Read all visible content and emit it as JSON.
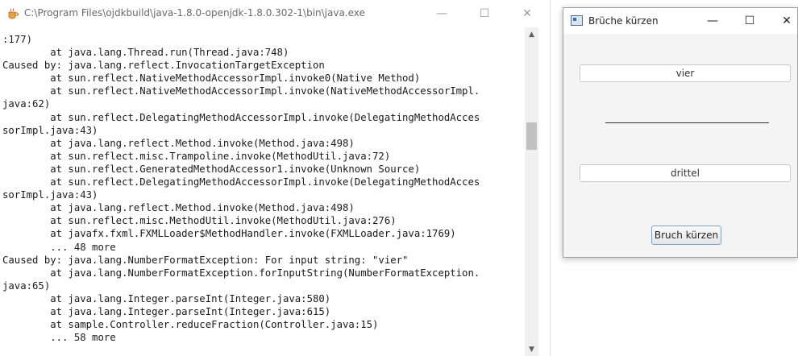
{
  "console": {
    "title": "C:\\Program Files\\ojdkbuild\\java-1.8.0-openjdk-1.8.0.302-1\\bin\\java.exe",
    "icon": "java-coffee-icon",
    "minimize": "—",
    "maximize": "☐",
    "close": "✕",
    "log": ":177)\n        at java.lang.Thread.run(Thread.java:748)\nCaused by: java.lang.reflect.InvocationTargetException\n        at sun.reflect.NativeMethodAccessorImpl.invoke0(Native Method)\n        at sun.reflect.NativeMethodAccessorImpl.invoke(NativeMethodAccessorImpl.\njava:62)\n        at sun.reflect.DelegatingMethodAccessorImpl.invoke(DelegatingMethodAcces\nsorImpl.java:43)\n        at java.lang.reflect.Method.invoke(Method.java:498)\n        at sun.reflect.misc.Trampoline.invoke(MethodUtil.java:72)\n        at sun.reflect.GeneratedMethodAccessor1.invoke(Unknown Source)\n        at sun.reflect.DelegatingMethodAccessorImpl.invoke(DelegatingMethodAcces\nsorImpl.java:43)\n        at java.lang.reflect.Method.invoke(Method.java:498)\n        at sun.reflect.misc.MethodUtil.invoke(MethodUtil.java:276)\n        at javafx.fxml.FXMLLoader$MethodHandler.invoke(FXMLLoader.java:1769)\n        ... 48 more\nCaused by: java.lang.NumberFormatException: For input string: \"vier\"\n        at java.lang.NumberFormatException.forInputString(NumberFormatException.\njava:65)\n        at java.lang.Integer.parseInt(Integer.java:580)\n        at java.lang.Integer.parseInt(Integer.java:615)\n        at sample.Controller.reduceFraction(Controller.java:15)\n        ... 58 more"
  },
  "app": {
    "title": "Brüche kürzen",
    "minimize": "—",
    "maximize": "☐",
    "close": "✕",
    "numerator_value": "vier",
    "denominator_value": "drittel",
    "button_label": "Bruch kürzen"
  },
  "colors": {
    "button_border": "#7ea1c7",
    "window_bg": "#f4f4f4"
  }
}
